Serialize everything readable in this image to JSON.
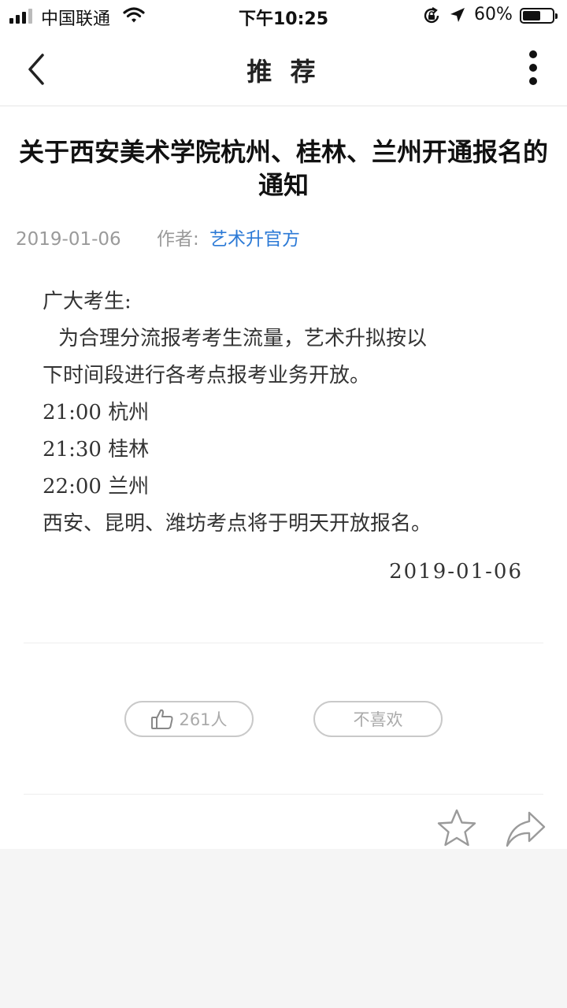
{
  "status_bar": {
    "carrier": "中国联通",
    "time": "下午10:25",
    "battery_percent": "60%",
    "battery_level": 0.6,
    "icons": [
      "signal-icon",
      "wifi-icon",
      "rotation-lock-icon",
      "location-icon",
      "battery-icon"
    ]
  },
  "nav": {
    "title": "推 荐",
    "back_icon": "chevron-left-icon",
    "more_icon": "more-vertical-icon"
  },
  "article": {
    "title": "关于西安美术学院杭州、桂林、兰州开通报名的通知",
    "date": "2019-01-06",
    "author_label": "作者:",
    "author": "艺术升官方",
    "author_color": "#2c7ad6",
    "body": {
      "greeting": "广大考生:",
      "intro_line1": "为合理分流报考考生流量，艺术升拟按以",
      "intro_line2": "下时间段进行各考点报考业务开放。",
      "schedule": [
        {
          "time": "21:00",
          "place": "杭州"
        },
        {
          "time": "21:30",
          "place": "桂林"
        },
        {
          "time": "22:00",
          "place": "兰州"
        }
      ],
      "closing": "西安、昆明、潍坊考点将于明天开放报名。",
      "signed_date": "2019-01-06"
    }
  },
  "reactions": {
    "like_count": "261人",
    "like_icon": "thumbs-up-icon",
    "dislike_label": "不喜欢"
  },
  "actions": {
    "favorite_icon": "star-icon",
    "share_icon": "share-arrow-icon"
  }
}
